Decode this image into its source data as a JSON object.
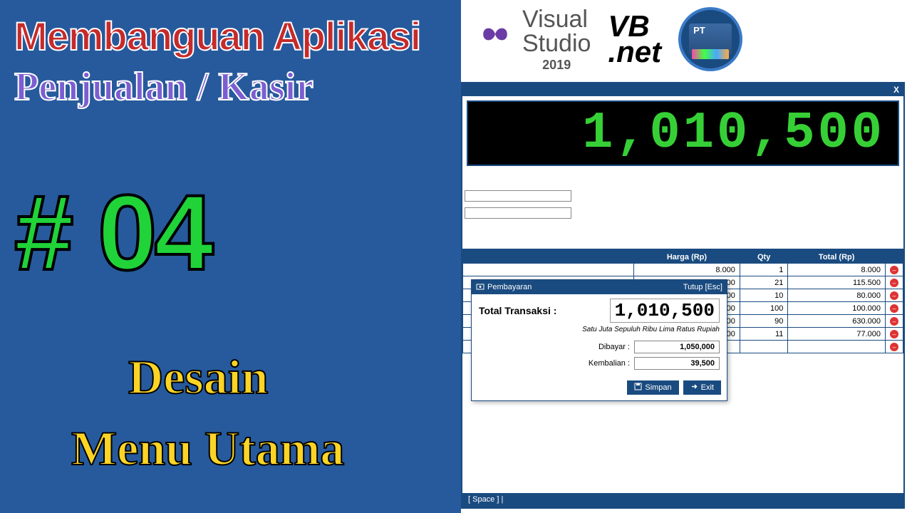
{
  "overlay": {
    "title_line1": "Membanguan Aplikasi",
    "title_line2": "Penjualan / Kasir",
    "episode": "# 04",
    "subtitle1": "Desain",
    "subtitle2": "Menu Utama"
  },
  "logos": {
    "vs_line1": "Visual",
    "vs_line2": "Studio",
    "vs_year": "2019",
    "vbnet_top": "VB",
    "vbnet_bottom": ".net",
    "pt_label": "PT"
  },
  "app": {
    "close_label": "X",
    "grand_total_display": "1,010,500",
    "table": {
      "headers": {
        "harga": "Harga (Rp)",
        "qty": "Qty",
        "total": "Total (Rp)"
      },
      "rows": [
        {
          "harga": "8.000",
          "qty": "1",
          "total": "8.000"
        },
        {
          "harga": "5.500",
          "qty": "21",
          "total": "115.500"
        },
        {
          "harga": "8.000",
          "qty": "10",
          "total": "80.000"
        },
        {
          "harga": "1.000",
          "qty": "100",
          "total": "100.000"
        },
        {
          "harga": "7.000",
          "qty": "90",
          "total": "630.000"
        },
        {
          "harga": "7.000",
          "qty": "11",
          "total": "77.000"
        }
      ],
      "empty_row_del": "⊖"
    },
    "payment": {
      "dialog_title_icon_label": "Pembayaran",
      "dialog_close_hint": "Tutup [Esc]",
      "total_label": "Total Transaksi   :",
      "total_value": "1,010,500",
      "terbilang": "Satu Juta Sepuluh Ribu Lima Ratus Rupiah",
      "dibayar_label": "Dibayar :",
      "dibayar_value": "1,050,000",
      "kembalian_label": "Kembalian :",
      "kembalian_value": "39,500",
      "btn_simpan": "Simpan",
      "btn_exit": "Exit"
    },
    "status_bar": "[ Space ] |"
  }
}
